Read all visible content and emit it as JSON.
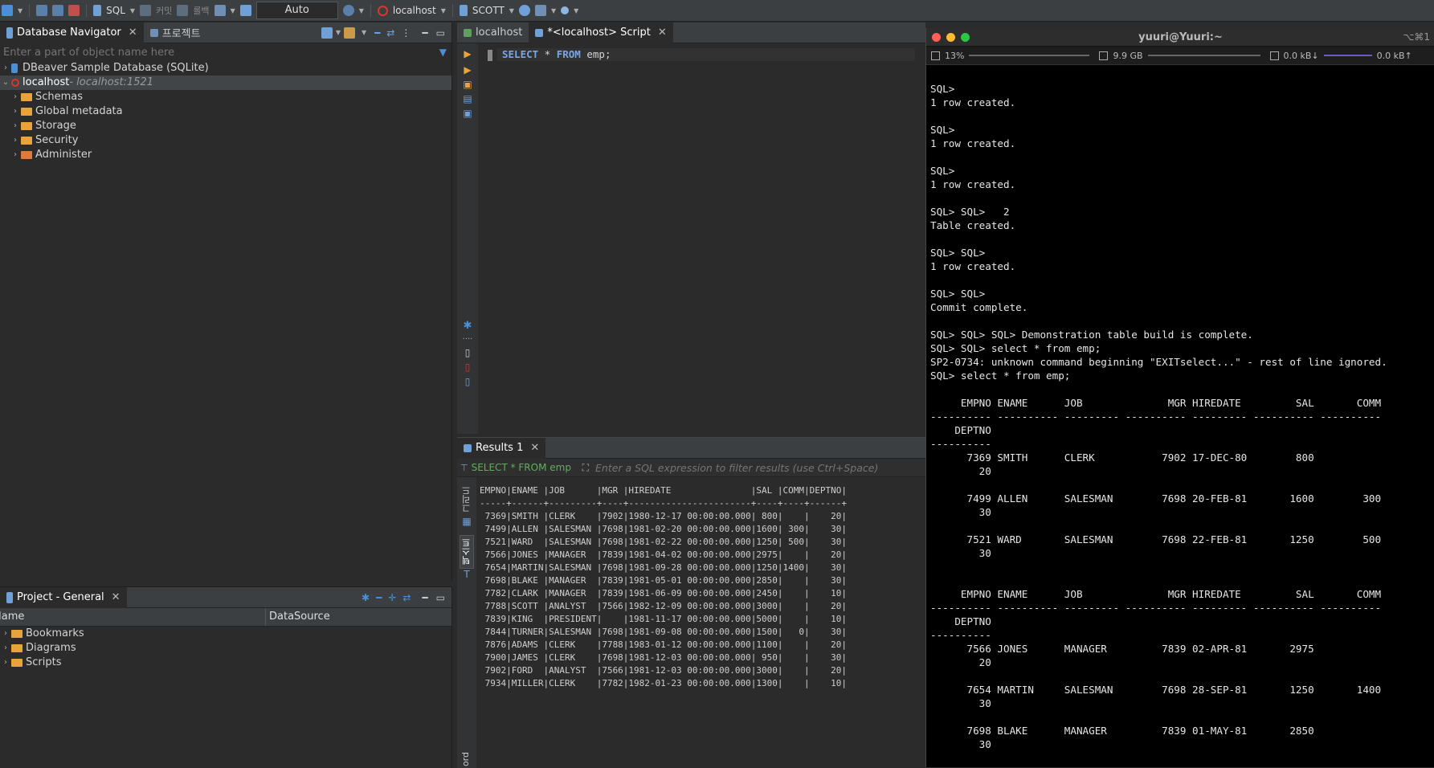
{
  "toolbar": {
    "sql_label": "SQL",
    "commit_label": "커밋",
    "rollback_label": "롤백",
    "txn_mode": "Auto",
    "connection": "localhost",
    "schema": "SCOTT"
  },
  "navigator": {
    "tab_label": "Database Navigator",
    "project_tab_label": "프로젝트",
    "filter_placeholder": "Enter a part of object name here",
    "items": [
      {
        "label": "DBeaver Sample Database (SQLite)",
        "sub": ""
      },
      {
        "label": "localhost",
        "sub": " - localhost:1521"
      }
    ],
    "children": [
      "Schemas",
      "Global metadata",
      "Storage",
      "Security",
      "Administer"
    ]
  },
  "project": {
    "tab_label": "Project - General",
    "col_name": "Name",
    "col_datasource": "DataSource",
    "items": [
      "Bookmarks",
      "Diagrams",
      "Scripts"
    ]
  },
  "editor": {
    "tab1": "localhost",
    "tab2": "*<localhost> Script",
    "sql_kw1": "SELECT",
    "sql_rest1": " * ",
    "sql_kw2": "FROM",
    "sql_rest2": " emp;"
  },
  "results": {
    "tab_label": "Results 1",
    "query_label": "SELECT * FROM emp",
    "filter_placeholder": "Enter a SQL expression to filter results (use Ctrl+Space)",
    "side_grid": "그리드",
    "side_text": "텍스트",
    "side_record": "ord",
    "text": "EMPNO|ENAME |JOB      |MGR |HIREDATE               |SAL |COMM|DEPTNO|\n-----+------+---------+----+-----------------------+----+----+------+\n 7369|SMITH |CLERK    |7902|1980-12-17 00:00:00.000| 800|    |    20|\n 7499|ALLEN |SALESMAN |7698|1981-02-20 00:00:00.000|1600| 300|    30|\n 7521|WARD  |SALESMAN |7698|1981-02-22 00:00:00.000|1250| 500|    30|\n 7566|JONES |MANAGER  |7839|1981-04-02 00:00:00.000|2975|    |    20|\n 7654|MARTIN|SALESMAN |7698|1981-09-28 00:00:00.000|1250|1400|    30|\n 7698|BLAKE |MANAGER  |7839|1981-05-01 00:00:00.000|2850|    |    30|\n 7782|CLARK |MANAGER  |7839|1981-06-09 00:00:00.000|2450|    |    10|\n 7788|SCOTT |ANALYST  |7566|1982-12-09 00:00:00.000|3000|    |    20|\n 7839|KING  |PRESIDENT|    |1981-11-17 00:00:00.000|5000|    |    10|\n 7844|TURNER|SALESMAN |7698|1981-09-08 00:00:00.000|1500|   0|    30|\n 7876|ADAMS |CLERK    |7788|1983-01-12 00:00:00.000|1100|    |    20|\n 7900|JAMES |CLERK    |7698|1981-12-03 00:00:00.000| 950|    |    30|\n 7902|FORD  |ANALYST  |7566|1981-12-03 00:00:00.000|3000|    |    20|\n 7934|MILLER|CLERK    |7782|1982-01-23 00:00:00.000|1300|    |    10|"
  },
  "terminal": {
    "title": "yuuri@Yuuri:~",
    "shortcut": "⌥⌘1",
    "cpu": "13%",
    "mem": "9.9 GB",
    "net_down": "0.0 kB↓",
    "net_up": "0.0 kB↑",
    "text": "\nSQL>\n1 row created.\n\nSQL>\n1 row created.\n\nSQL>\n1 row created.\n\nSQL> SQL>   2\nTable created.\n\nSQL> SQL>\n1 row created.\n\nSQL> SQL>\nCommit complete.\n\nSQL> SQL> SQL> Demonstration table build is complete.\nSQL> SQL> select * from emp;\nSP2-0734: unknown command beginning \"EXITselect...\" - rest of line ignored.\nSQL> select * from emp;\n\n     EMPNO ENAME      JOB              MGR HIREDATE         SAL       COMM\n---------- ---------- --------- ---------- --------- ---------- ----------\n    DEPTNO\n----------\n      7369 SMITH      CLERK           7902 17-DEC-80        800\n        20\n\n      7499 ALLEN      SALESMAN        7698 20-FEB-81       1600        300\n        30\n\n      7521 WARD       SALESMAN        7698 22-FEB-81       1250        500\n        30\n\n\n     EMPNO ENAME      JOB              MGR HIREDATE         SAL       COMM\n---------- ---------- --------- ---------- --------- ---------- ----------\n    DEPTNO\n----------\n      7566 JONES      MANAGER         7839 02-APR-81       2975\n        20\n\n      7654 MARTIN     SALESMAN        7698 28-SEP-81       1250       1400\n        30\n\n      7698 BLAKE      MANAGER         7839 01-MAY-81       2850\n        30"
  }
}
